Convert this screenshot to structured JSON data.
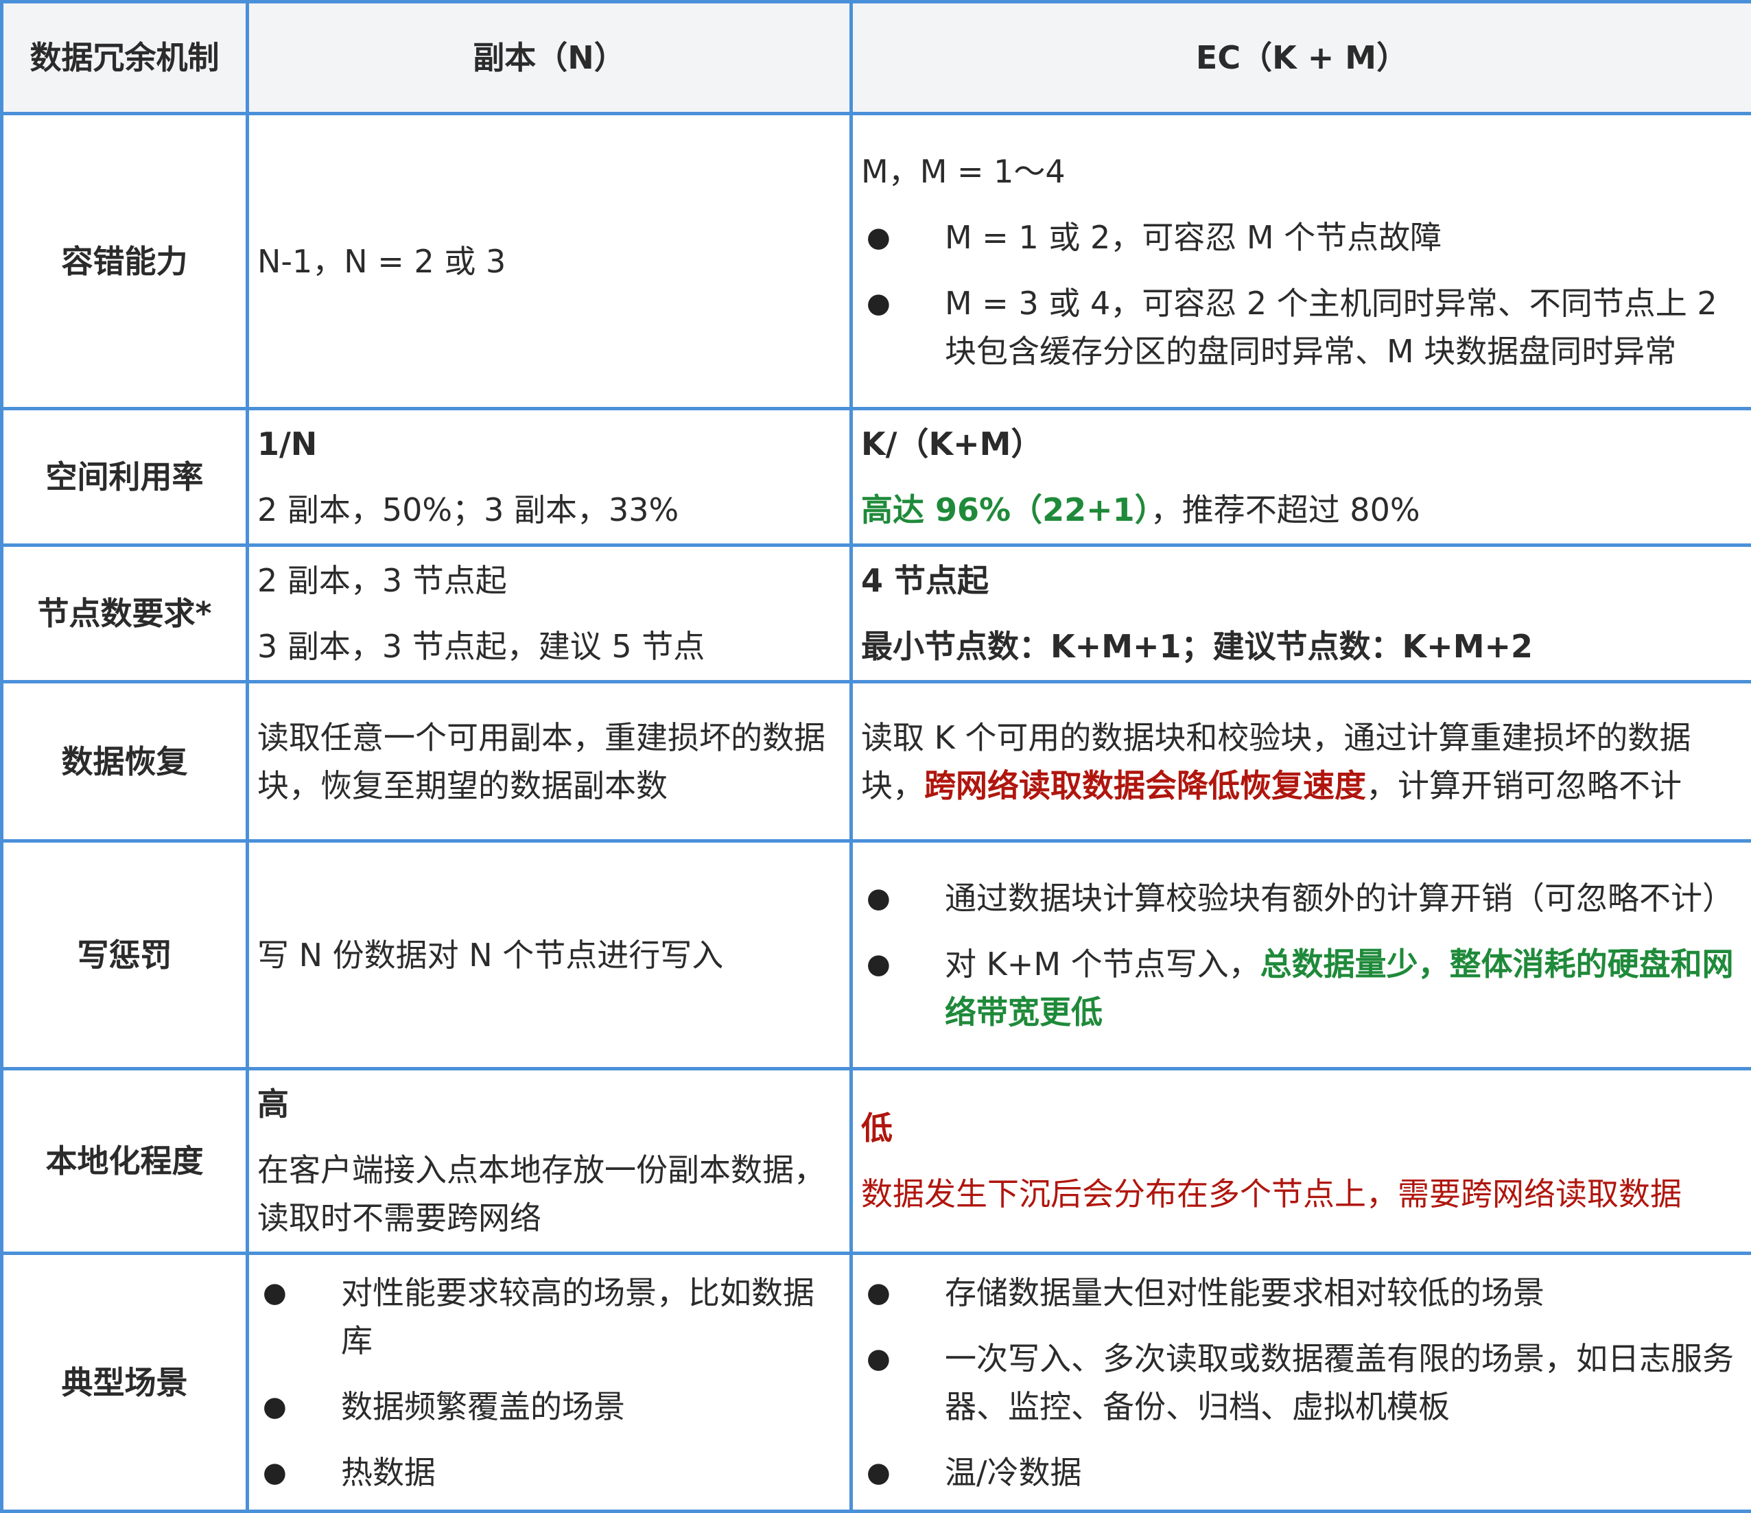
{
  "header": {
    "col1": "数据冗余机制",
    "col2": "副本（N）",
    "col3": "EC（K + M）"
  },
  "rows": {
    "fault_tolerance": {
      "label": "容错能力",
      "replica": "N-1，N = 2 或 3",
      "ec_intro": "M，M = 1～4",
      "ec_bullets": [
        "M = 1 或 2，可容忍 M 个节点故障",
        "M = 3 或 4，可容忍 2 个主机同时异常、不同节点上 2 块包含缓存分区的盘同时异常、M 块数据盘同时异常"
      ],
      "bullet_symbol": "●"
    },
    "space_utilization": {
      "label": "空间利用率",
      "replica_line1": "1/N",
      "replica_line2": "2 副本，50%；3 副本，33%",
      "ec_line1": "K/（K+M）",
      "ec_line2_green": "高达 96%（22+1）",
      "ec_line2_rest": "，推荐不超过 80%"
    },
    "node_requirement": {
      "label": "节点数要求*",
      "replica_line1": "2 副本，3 节点起",
      "replica_line2": "3 副本，3 节点起，建议 5 节点",
      "ec_line1": "4 节点起",
      "ec_line2": "最小节点数：K+M+1；建议节点数：K+M+2"
    },
    "data_recovery": {
      "label": "数据恢复",
      "replica": "读取任意一个可用副本，重建损坏的数据块，恢复至期望的数据副本数",
      "ec_part1": "读取 K 个可用的数据块和校验块，通过计算重建损坏的数据块，",
      "ec_part2_red": "跨网络读取数据会降低恢复速度",
      "ec_part3": "，计算开销可忽略不计"
    },
    "write_penalty": {
      "label": "写惩罚",
      "replica": "写 N 份数据对 N 个节点进行写入",
      "ec_bullet1": "通过数据块计算校验块有额外的计算开销（可忽略不计）",
      "ec_bullet2_plain": "对 K+M 个节点写入，",
      "ec_bullet2_green": "总数据量少，整体消耗的硬盘和网络带宽更低"
    },
    "locality": {
      "label": "本地化程度",
      "replica_line1": "高",
      "replica_line2": "在客户端接入点本地存放一份副本数据，读取时不需要跨网络",
      "ec_line1": "低",
      "ec_line2": "数据发生下沉后会分布在多个节点上，需要跨网络读取数据"
    },
    "scenarios": {
      "label": "典型场景",
      "replica_bullets": [
        "对性能要求较高的场景，比如数据库",
        "数据频繁覆盖的场景",
        "热数据"
      ],
      "ec_bullets": [
        "存储数据量大但对性能要求相对较低的场景",
        "一次写入、多次读取或数据覆盖有限的场景，如日志服务器、监控、备份、归档、虚拟机模板",
        "温/冷数据"
      ]
    }
  },
  "colors": {
    "border": "#4a90d9",
    "header_bg": "#f3f4f6",
    "green": "#1f8a3a",
    "red": "#b0160e"
  }
}
